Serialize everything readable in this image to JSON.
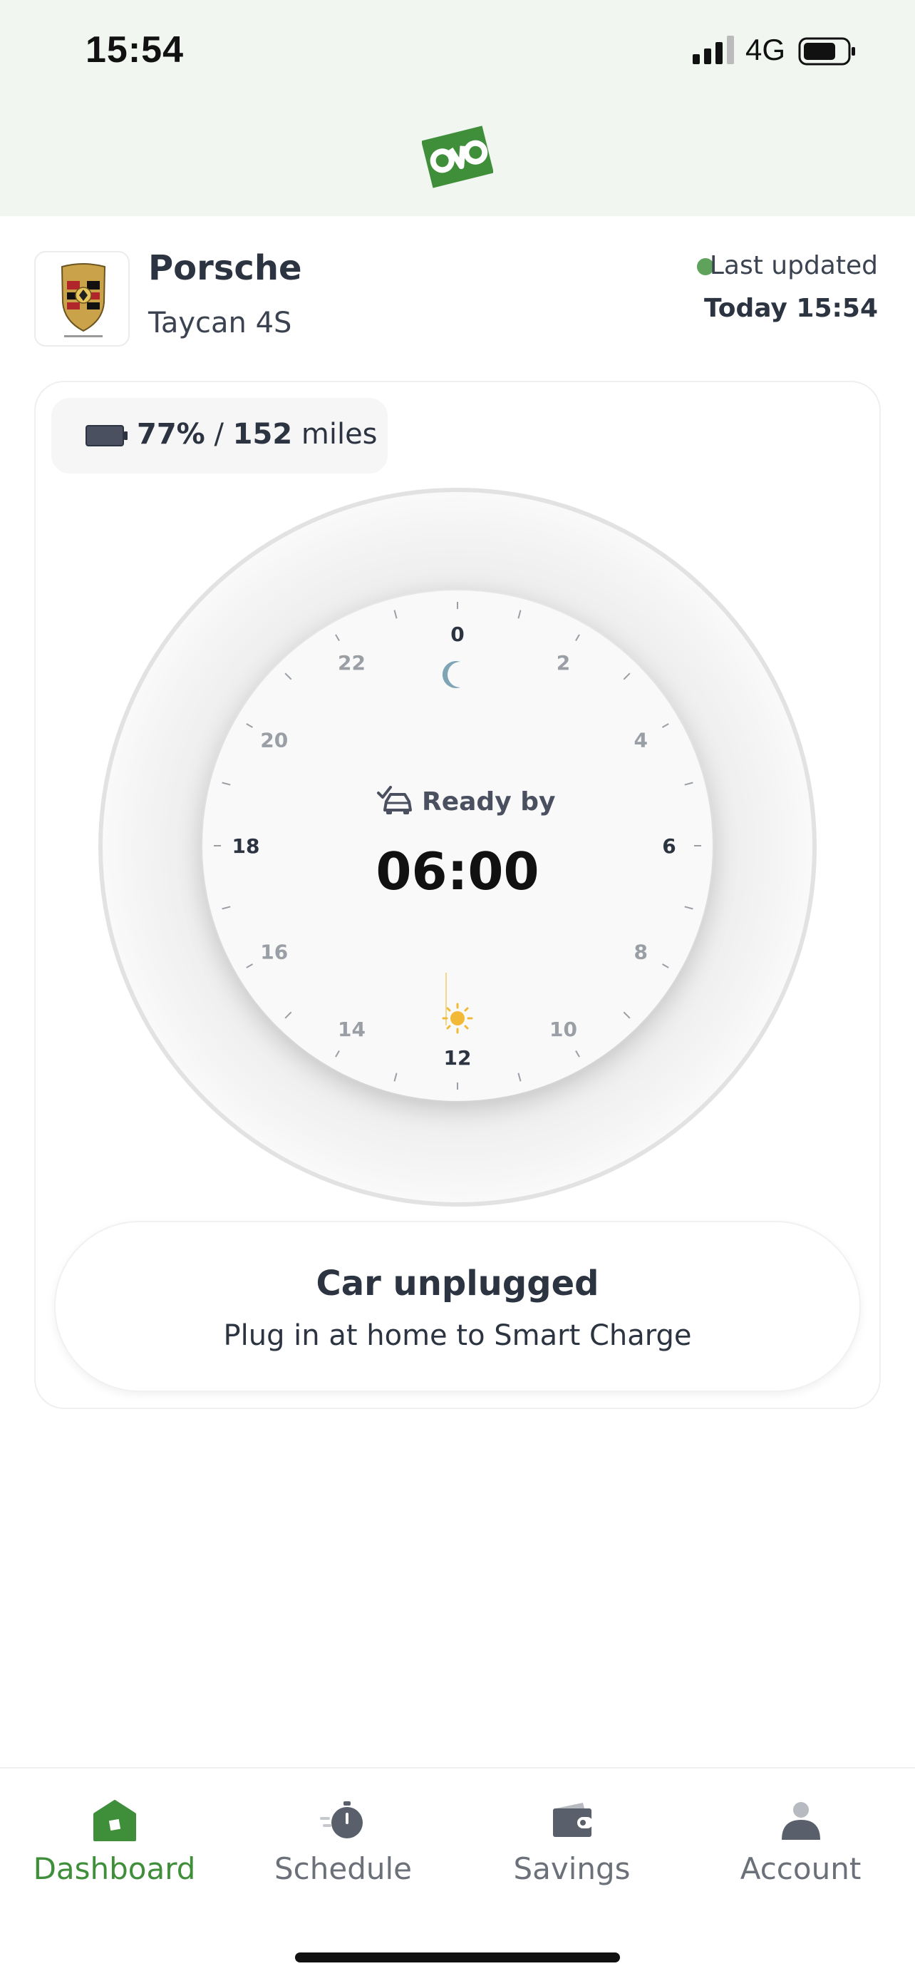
{
  "status_bar": {
    "time": "15:54",
    "network": "4G"
  },
  "vehicle": {
    "make": "Porsche",
    "model": "Taycan 4S",
    "logo_icon": "porsche-crest-icon",
    "last_updated_label": "Last updated",
    "last_updated_time": "Today 15:54",
    "status_dot_color": "#5fa25b"
  },
  "battery": {
    "percent": "77%",
    "separator": " / ",
    "range": "152",
    "unit": " miles",
    "percent_value": 77
  },
  "clock": {
    "hour_labels": [
      "0",
      "2",
      "4",
      "6",
      "8",
      "10",
      "12",
      "14",
      "16",
      "18",
      "20",
      "22"
    ],
    "night_icon": "moon-icon",
    "day_icon": "sun-icon",
    "ready_label": "Ready by",
    "ready_time": "06:00"
  },
  "charging_status": {
    "title": "Car unplugged",
    "subtitle": "Plug in at home to Smart Charge"
  },
  "nav": {
    "items": [
      {
        "label": "Dashboard",
        "icon": "home-icon",
        "active": true
      },
      {
        "label": "Schedule",
        "icon": "stopwatch-icon",
        "active": false
      },
      {
        "label": "Savings",
        "icon": "wallet-icon",
        "active": false
      },
      {
        "label": "Account",
        "icon": "user-icon",
        "active": false
      }
    ]
  },
  "colors": {
    "brand_green": "#3f8f3a",
    "header_bg": "#f1f6f1",
    "moon": "#7fa5b5",
    "sun": "#f2b936"
  }
}
